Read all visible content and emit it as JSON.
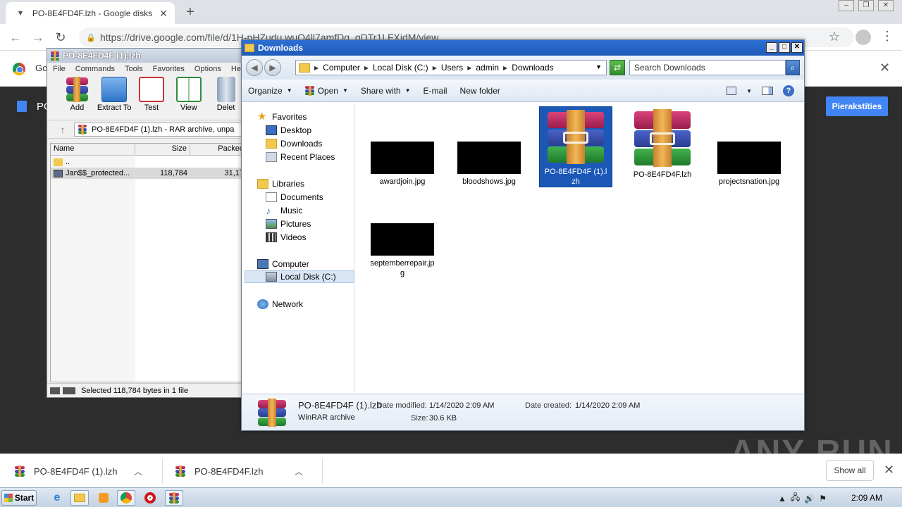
{
  "browser": {
    "tab_title": "PO-8E4FD4F.lzh - Google disks",
    "new_tab": "+",
    "url": "https://drive.google.com/file/d/1H-pHZudu.wuO4ll7amfDg_gDTr1LFXidM/view",
    "infobar_text": "Go",
    "drive_title": "PO",
    "signin_label": "Pierakstīties"
  },
  "winrar": {
    "title": "PO-8E4FD4F (1).lzh",
    "menu": [
      "File",
      "Commands",
      "Tools",
      "Favorites",
      "Options",
      "Help"
    ],
    "tools": [
      "Add",
      "Extract To",
      "Test",
      "View",
      "Delet"
    ],
    "path": "PO-8E4FD4F (1).lzh - RAR archive, unpa",
    "columns": [
      "Name",
      "Size",
      "Packed"
    ],
    "rows": [
      {
        "name": "..",
        "size": "",
        "packed": ""
      },
      {
        "name": "Jan$$_protected...",
        "size": "118,784",
        "packed": "31,17"
      }
    ],
    "status": "Selected 118,784 bytes in 1 file"
  },
  "explorer": {
    "title": "Downloads",
    "breadcrumb": [
      "Computer",
      "Local Disk (C:)",
      "Users",
      "admin",
      "Downloads"
    ],
    "search_placeholder": "Search Downloads",
    "commands": [
      "Organize",
      "Open",
      "Share with",
      "E-mail",
      "New folder"
    ],
    "nav": {
      "favorites": "Favorites",
      "favorites_items": [
        "Desktop",
        "Downloads",
        "Recent Places"
      ],
      "libraries": "Libraries",
      "libraries_items": [
        "Documents",
        "Music",
        "Pictures",
        "Videos"
      ],
      "computer": "Computer",
      "computer_items": [
        "Local Disk (C:)"
      ],
      "network": "Network"
    },
    "files": [
      {
        "name": "awardjoin.jpg",
        "kind": "image"
      },
      {
        "name": "bloodshows.jpg",
        "kind": "image"
      },
      {
        "name": "PO-8E4FD4F (1).lzh",
        "kind": "rar"
      },
      {
        "name": "PO-8E4FD4F.lzh",
        "kind": "rar"
      },
      {
        "name": "projectsnation.jpg",
        "kind": "image"
      },
      {
        "name": "septemberrepair.jpg",
        "kind": "image"
      }
    ],
    "details": {
      "name": "PO-8E4FD4F (1).lzh",
      "type": "WinRAR archive",
      "date_modified_label": "Date modified:",
      "date_modified": "1/14/2020 2:09 AM",
      "size_label": "Size:",
      "size": "30.6 KB",
      "date_created_label": "Date created:",
      "date_created": "1/14/2020 2:09 AM"
    }
  },
  "downloads_bar": {
    "items": [
      "PO-8E4FD4F (1).lzh",
      "PO-8E4FD4F.lzh"
    ],
    "show_all": "Show all"
  },
  "taskbar": {
    "start": "Start",
    "clock": "2:09 AM"
  },
  "watermark": "ANY RUN"
}
